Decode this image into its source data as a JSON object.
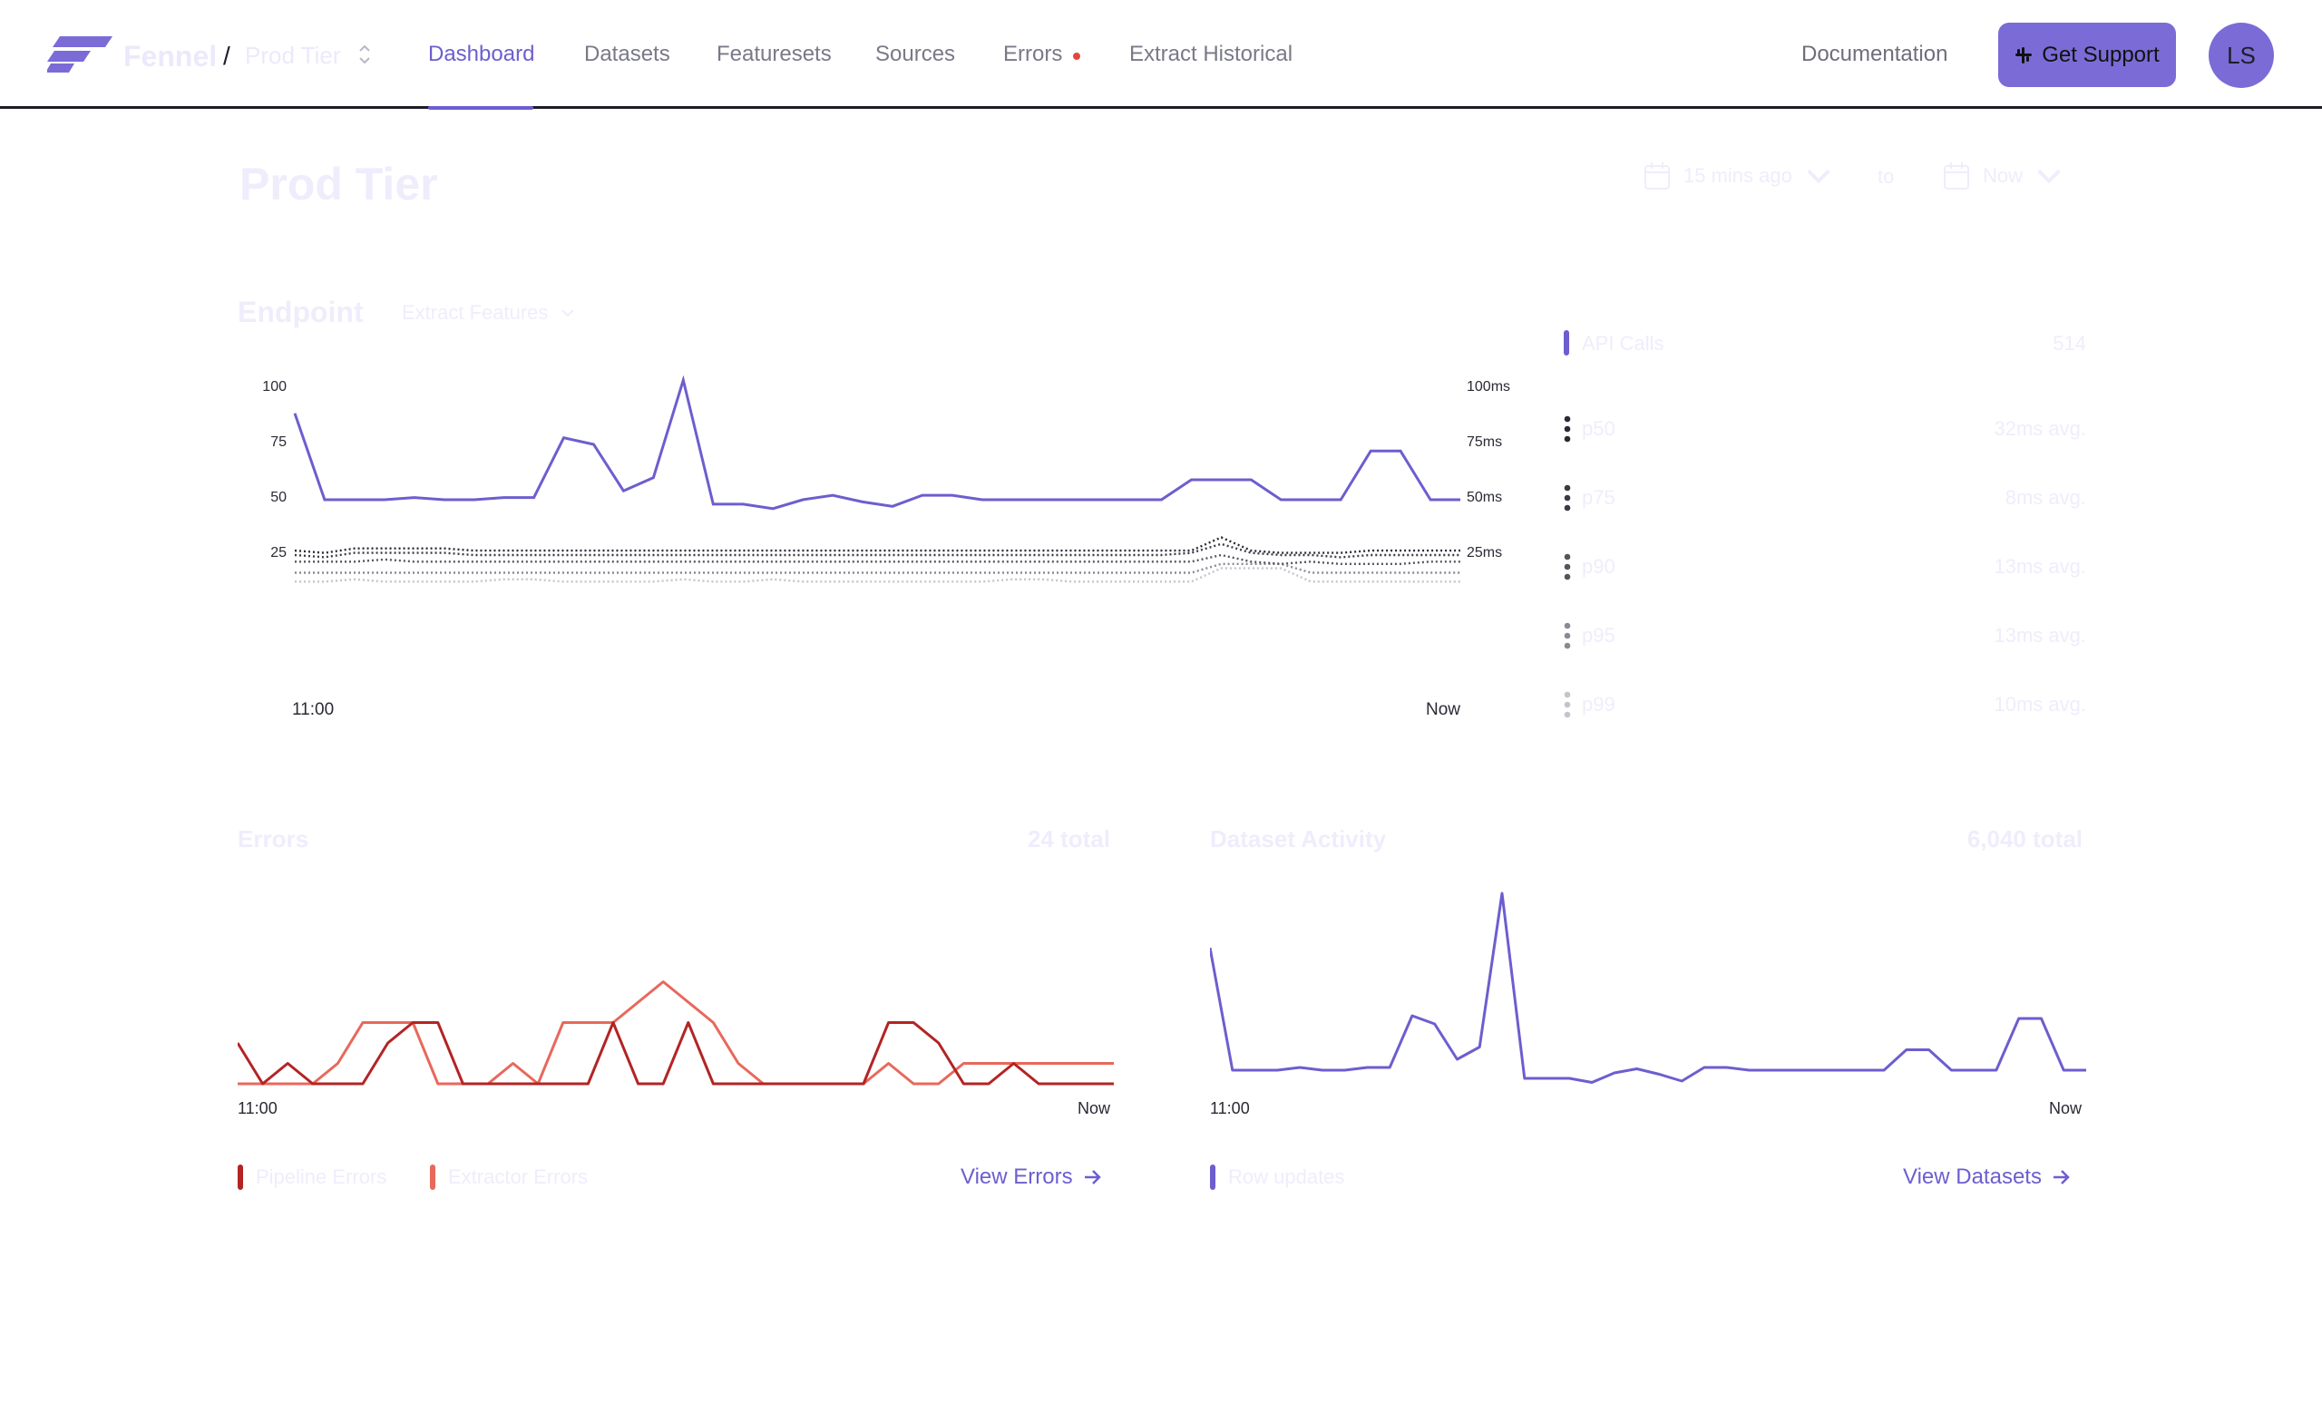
{
  "header": {
    "brand": "Fennel",
    "separator": "/",
    "tier": "Prod Tier",
    "nav": [
      {
        "label": "Dashboard",
        "active": true
      },
      {
        "label": "Datasets"
      },
      {
        "label": "Featuresets"
      },
      {
        "label": "Sources"
      },
      {
        "label": "Errors",
        "has_alert_dot": true
      },
      {
        "label": "Extract Historical"
      }
    ],
    "documentation": "Documentation",
    "support": "Get Support",
    "avatar_initials": "LS"
  },
  "page": {
    "title": "Prod Tier",
    "date_from": "15 mins ago",
    "date_to_label": "to",
    "date_to": "Now"
  },
  "endpoint": {
    "title": "Endpoint",
    "select": "Extract Features",
    "left_ticks": [
      "100",
      "75",
      "50",
      "25"
    ],
    "right_ticks": [
      "100ms",
      "75ms",
      "50ms",
      "25ms"
    ],
    "x_start": "11:00",
    "x_end": "Now",
    "legend": [
      {
        "name": "API Calls",
        "value": "514",
        "color": "#6c5ecf"
      },
      {
        "name": "p50",
        "value": "32ms avg.",
        "color": "#2a2a35"
      },
      {
        "name": "p75",
        "value": "8ms avg.",
        "color": "#3a3a45"
      },
      {
        "name": "p90",
        "value": "13ms avg.",
        "color": "#55555f"
      },
      {
        "name": "p95",
        "value": "13ms avg.",
        "color": "#8a8a95"
      },
      {
        "name": "p99",
        "value": "10ms avg.",
        "color": "#c4c4cc"
      }
    ]
  },
  "errors": {
    "title": "Errors",
    "total": "24 total",
    "x_start": "11:00",
    "x_end": "Now",
    "legend": [
      {
        "name": "Pipeline Errors",
        "color": "#b32424"
      },
      {
        "name": "Extractor Errors",
        "color": "#e8685c"
      }
    ],
    "link": "View Errors"
  },
  "datasets": {
    "title": "Dataset Activity",
    "total": "6,040 total",
    "x_start": "11:00",
    "x_end": "Now",
    "legend": [
      {
        "name": "Row updates",
        "color": "#6c5ecf"
      }
    ],
    "link": "View Datasets"
  },
  "chart_data": [
    {
      "type": "line",
      "y_ticks_left": [
        "100",
        "75",
        "50",
        "25"
      ],
      "y_ticks_right": [
        "100ms",
        "75ms",
        "50ms",
        "25ms"
      ],
      "ylim": [
        0,
        100
      ],
      "x_ticks": [
        "11:00",
        "Now"
      ],
      "series": [
        {
          "name": "API Calls",
          "color": "#6c5ecf",
          "values": [
            89,
            50,
            50,
            50,
            51,
            50,
            50,
            51,
            51,
            78,
            75,
            54,
            60,
            104,
            48,
            48,
            46,
            50,
            52,
            49,
            47,
            52,
            52,
            50,
            50,
            50,
            50,
            50,
            50,
            50,
            59,
            59,
            59,
            50,
            50,
            50,
            72,
            72,
            50,
            50
          ]
        },
        {
          "name": "p50",
          "color": "#2a2a35",
          "values": [
            27,
            26,
            28,
            28,
            28,
            28,
            27,
            27,
            27,
            27,
            27,
            27,
            27,
            27,
            27,
            27,
            27,
            27,
            27,
            27,
            27,
            27,
            27,
            27,
            27,
            27,
            27,
            27,
            27,
            27,
            27,
            33,
            27,
            26,
            26,
            26,
            27,
            27,
            27,
            27
          ]
        },
        {
          "name": "p75",
          "color": "#3a3a45",
          "values": [
            25,
            24,
            26,
            26,
            26,
            26,
            25,
            25,
            25,
            25,
            25,
            25,
            25,
            25,
            25,
            25,
            25,
            25,
            25,
            25,
            25,
            25,
            25,
            25,
            25,
            25,
            25,
            25,
            25,
            25,
            26,
            30,
            26,
            25,
            25,
            24,
            25,
            25,
            25,
            25
          ]
        },
        {
          "name": "p90",
          "color": "#55555f",
          "values": [
            22,
            22,
            22,
            23,
            22,
            22,
            22,
            22,
            22,
            22,
            22,
            22,
            22,
            22,
            22,
            22,
            22,
            22,
            22,
            22,
            22,
            22,
            22,
            22,
            22,
            22,
            22,
            22,
            22,
            22,
            22,
            25,
            22,
            21,
            22,
            21,
            21,
            21,
            22,
            22
          ]
        },
        {
          "name": "p95",
          "color": "#8a8a95",
          "values": [
            17,
            17,
            17,
            17,
            17,
            17,
            17,
            17,
            17,
            17,
            17,
            17,
            17,
            17,
            17,
            17,
            17,
            17,
            17,
            17,
            17,
            17,
            17,
            17,
            17,
            17,
            17,
            17,
            17,
            17,
            17,
            21,
            21,
            21,
            17,
            17,
            17,
            17,
            17,
            17
          ]
        },
        {
          "name": "p99",
          "color": "#c4c4cc",
          "values": [
            13,
            13,
            14,
            13,
            13,
            13,
            13,
            14,
            14,
            13,
            13,
            13,
            13,
            14,
            13,
            13,
            14,
            13,
            13,
            13,
            13,
            13,
            13,
            13,
            14,
            14,
            13,
            13,
            13,
            13,
            13,
            19,
            19,
            19,
            13,
            13,
            13,
            13,
            13,
            13
          ]
        }
      ]
    },
    {
      "type": "line",
      "x_ticks": [
        "11:00",
        "Now"
      ],
      "ylim": [
        0,
        10
      ],
      "series": [
        {
          "name": "Pipeline Errors",
          "color": "#b32424",
          "values": [
            2,
            0,
            1,
            0,
            0,
            0,
            2,
            3,
            3,
            0,
            0,
            0,
            0,
            0,
            0,
            3,
            0,
            0,
            3,
            0,
            0,
            0,
            0,
            0,
            0,
            0,
            3,
            3,
            2,
            0,
            0,
            1,
            0,
            0,
            0,
            0
          ]
        },
        {
          "name": "Extractor Errors",
          "color": "#e8685c",
          "values": [
            0,
            0,
            0,
            0,
            1,
            3,
            3,
            3,
            0,
            0,
            0,
            1,
            0,
            3,
            3,
            3,
            4,
            5,
            4,
            3,
            1,
            0,
            0,
            0,
            0,
            0,
            1,
            0,
            0,
            1,
            1,
            1,
            1,
            1,
            1,
            1
          ]
        }
      ]
    },
    {
      "type": "line",
      "x_ticks": [
        "11:00",
        "Now"
      ],
      "ylim": [
        0,
        150
      ],
      "series": [
        {
          "name": "Row updates",
          "color": "#6c5ecf",
          "values": [
            100,
            10,
            10,
            10,
            12,
            10,
            10,
            12,
            12,
            50,
            44,
            18,
            27,
            140,
            4,
            4,
            4,
            1,
            8,
            11,
            7,
            2,
            12,
            12,
            10,
            10,
            10,
            10,
            10,
            10,
            10,
            25,
            25,
            10,
            10,
            10,
            48,
            48,
            10,
            10
          ]
        }
      ]
    }
  ]
}
